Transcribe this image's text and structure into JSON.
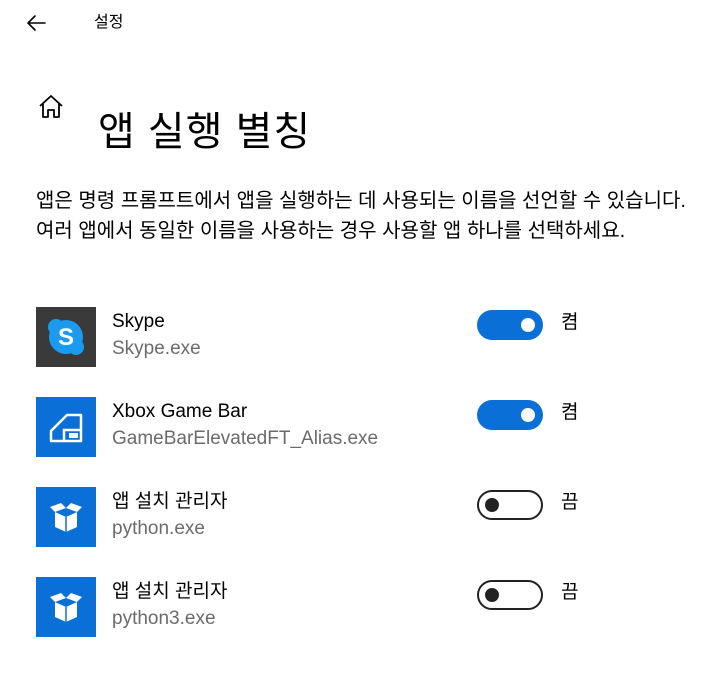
{
  "window": {
    "title": "설정"
  },
  "page": {
    "title": "앱 실행 별칭"
  },
  "description": "앱은 명령 프롬프트에서 앱을 실행하는 데 사용되는 이름을 선언할 수 있습니다. 여러 앱에서 동일한 이름을 사용하는 경우 사용할 앱 하나를 선택하세요.",
  "apps": [
    {
      "name": "Skype",
      "exe": "Skype.exe",
      "enabled": true,
      "state_label": "켬",
      "icon": "skype-icon",
      "tile_color": "#3a3a3a"
    },
    {
      "name": "Xbox Game Bar",
      "exe": "GameBarElevatedFT_Alias.exe",
      "enabled": true,
      "state_label": "켬",
      "icon": "game-bar-icon",
      "tile_color": "#0a6fd6"
    },
    {
      "name": "앱 설치 관리자",
      "exe": "python.exe",
      "enabled": false,
      "state_label": "끔",
      "icon": "package-icon",
      "tile_color": "#0a6fd6"
    },
    {
      "name": "앱 설치 관리자",
      "exe": "python3.exe",
      "enabled": false,
      "state_label": "끔",
      "icon": "package-icon",
      "tile_color": "#0a6fd6"
    }
  ],
  "colors": {
    "accent": "#0a6fd6",
    "secondary_text": "#6b6b6b"
  }
}
